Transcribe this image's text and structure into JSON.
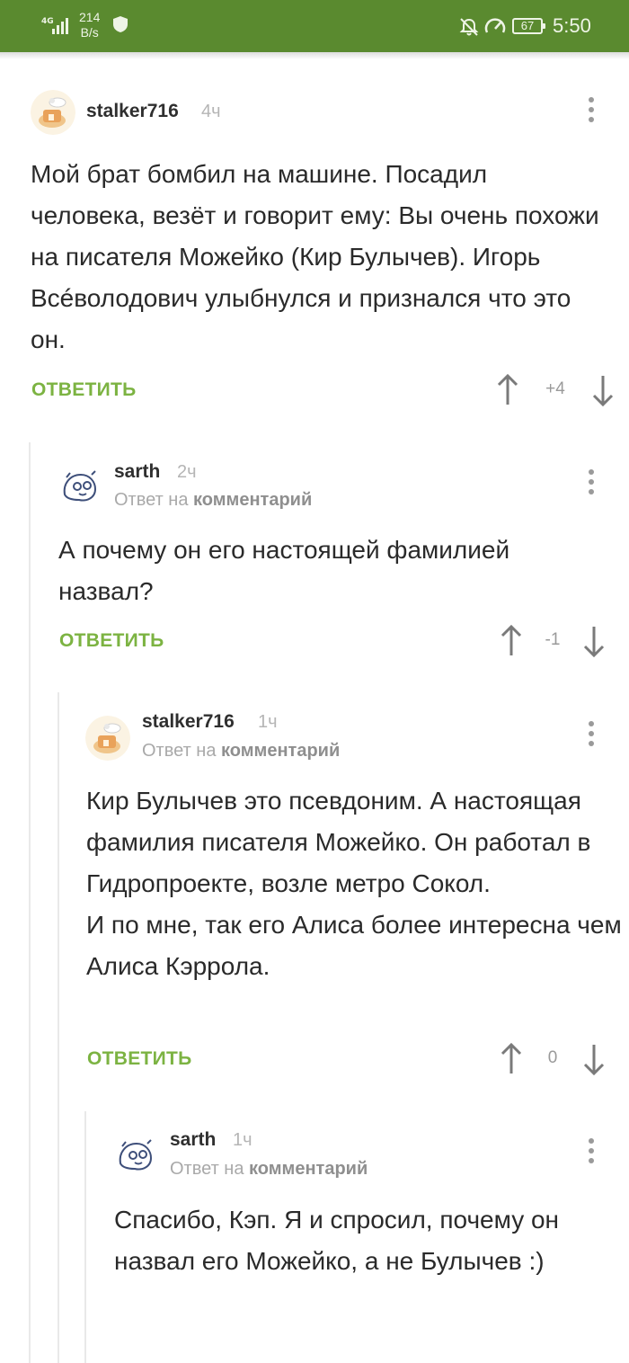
{
  "status_bar": {
    "network": "4G",
    "speed_value": "214",
    "speed_unit": "B/s",
    "battery": "67",
    "time": "5:50"
  },
  "comments": [
    {
      "author": "stalker716",
      "time": "4ч",
      "reply_to_prefix": "",
      "reply_to_target": "",
      "text": "Мой брат бомбил на машине. Посадил человека, везёт и говорит ему: Вы очень похожи на писателя Можейко (Кир Булычев). Игорь Всéволодович улыбнулся и признался что это он.",
      "reply_label": "ОТВЕТИТЬ",
      "score": "+4"
    },
    {
      "author": "sarth",
      "time": "2ч",
      "reply_to_prefix": "Ответ на",
      "reply_to_target": "комментарий",
      "text": "А почему он его настоящей фамилией назвал?",
      "reply_label": "ОТВЕТИТЬ",
      "score": "-1"
    },
    {
      "author": "stalker716",
      "time": "1ч",
      "reply_to_prefix": "Ответ на",
      "reply_to_target": "комментарий",
      "text": "Кир Булычев это псевдоним. А настоящая фамилия писателя Можейко. Он работал в Гидропроекте, возле метро Сокол.\nИ по мне, так его Алиса более интересна чем Алиса Кэррола.",
      "reply_label": "ОТВЕТИТЬ",
      "score": "0"
    },
    {
      "author": "sarth",
      "time": "1ч",
      "reply_to_prefix": "Ответ на",
      "reply_to_target": "комментарий",
      "text": "Спасибо, Кэп. Я и спросил, почему он назвал его Можейко, а не Булычев :)"
    }
  ],
  "colors": {
    "status_bar": "#5a8a2f",
    "reply_button": "#7cb342",
    "text": "#2a2a2a"
  }
}
